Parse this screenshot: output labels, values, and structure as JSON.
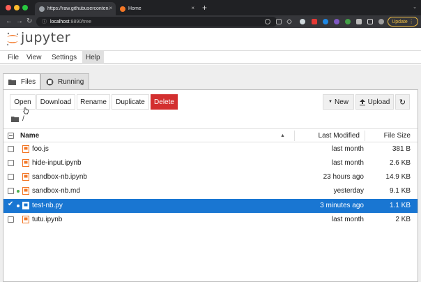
{
  "browser": {
    "tabs": [
      {
        "title": "https://raw.githubuserconten..."
      },
      {
        "title": "Home"
      }
    ],
    "url_host": "localhost",
    "url_path": ":8890/tree",
    "update_label": "Update"
  },
  "app": {
    "logo_text": "jupyter"
  },
  "menu": [
    "File",
    "View",
    "Settings",
    "Help"
  ],
  "panel_tabs": [
    "Files",
    "Running"
  ],
  "toolbar": {
    "open": "Open",
    "download": "Download",
    "rename": "Rename",
    "duplicate": "Duplicate",
    "delete": "Delete",
    "new": "New",
    "upload": "Upload"
  },
  "breadcrumb": "/",
  "columns": {
    "name": "Name",
    "modified": "Last Modified",
    "size": "File Size"
  },
  "files": [
    {
      "name": "foo.js",
      "modified": "last month",
      "size": "381 B",
      "running": false,
      "selected": false
    },
    {
      "name": "hide-input.ipynb",
      "modified": "last month",
      "size": "2.6 KB",
      "running": false,
      "selected": false
    },
    {
      "name": "sandbox-nb.ipynb",
      "modified": "23 hours ago",
      "size": "14.9 KB",
      "running": false,
      "selected": false
    },
    {
      "name": "sandbox-nb.md",
      "modified": "yesterday",
      "size": "9.1 KB",
      "running": true,
      "selected": false
    },
    {
      "name": "test-nb.py",
      "modified": "3 minutes ago",
      "size": "1.1 KB",
      "running": true,
      "selected": true
    },
    {
      "name": "tutu.ipynb",
      "modified": "last month",
      "size": "2 KB",
      "running": false,
      "selected": false
    }
  ],
  "colors": {
    "accent": "#1976d2",
    "delete": "#d32f2f",
    "jupyter_orange": "#f37726",
    "running_dot": "#4caf50"
  }
}
